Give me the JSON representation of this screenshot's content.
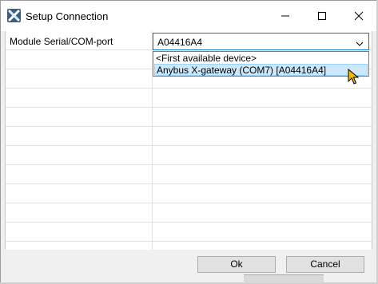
{
  "window": {
    "title": "Setup Connection",
    "app_icon": "anybus-x-icon",
    "controls": {
      "minimize_icon": "minimize-icon",
      "maximize_icon": "maximize-icon",
      "close_icon": "close-icon"
    }
  },
  "grid": {
    "rows": [
      {
        "label": "Module Serial/COM-port",
        "value": "A04416A4"
      }
    ]
  },
  "combo": {
    "selected_value": "A04416A4",
    "arrow_icon": "chevron-down-icon",
    "options": [
      "<First available device>",
      "Anybus X-gateway (COM7) [A04416A4]"
    ],
    "highlighted_index": 1
  },
  "buttons": {
    "ok_label": "Ok",
    "cancel_label": "Cancel"
  },
  "colors": {
    "accent": "#0078d7",
    "highlight": "#cce8ff",
    "cursor": "#f5b800"
  }
}
